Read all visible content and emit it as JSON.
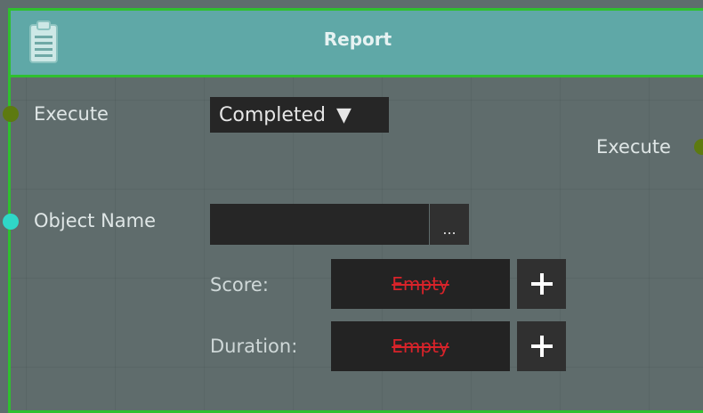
{
  "node": {
    "title": "Report",
    "icon": "clipboard-icon",
    "accent_color": "#2fc02f",
    "header_color": "#5fa8a7"
  },
  "inputs": {
    "execute_label": "Execute",
    "object_name_label": "Object Name",
    "object_name_value": "",
    "browse_label": "..."
  },
  "outputs": {
    "execute_label": "Execute"
  },
  "dropdown": {
    "selected": "Completed",
    "arrow": "▼"
  },
  "fields": {
    "score_label": "Score:",
    "score_value": "Empty",
    "duration_label": "Duration:",
    "duration_value": "Empty",
    "add_symbol": "+"
  },
  "colors": {
    "exec_pin": "#5d7a10",
    "data_pin": "#2fd7c8",
    "empty_text": "#d8232a"
  }
}
